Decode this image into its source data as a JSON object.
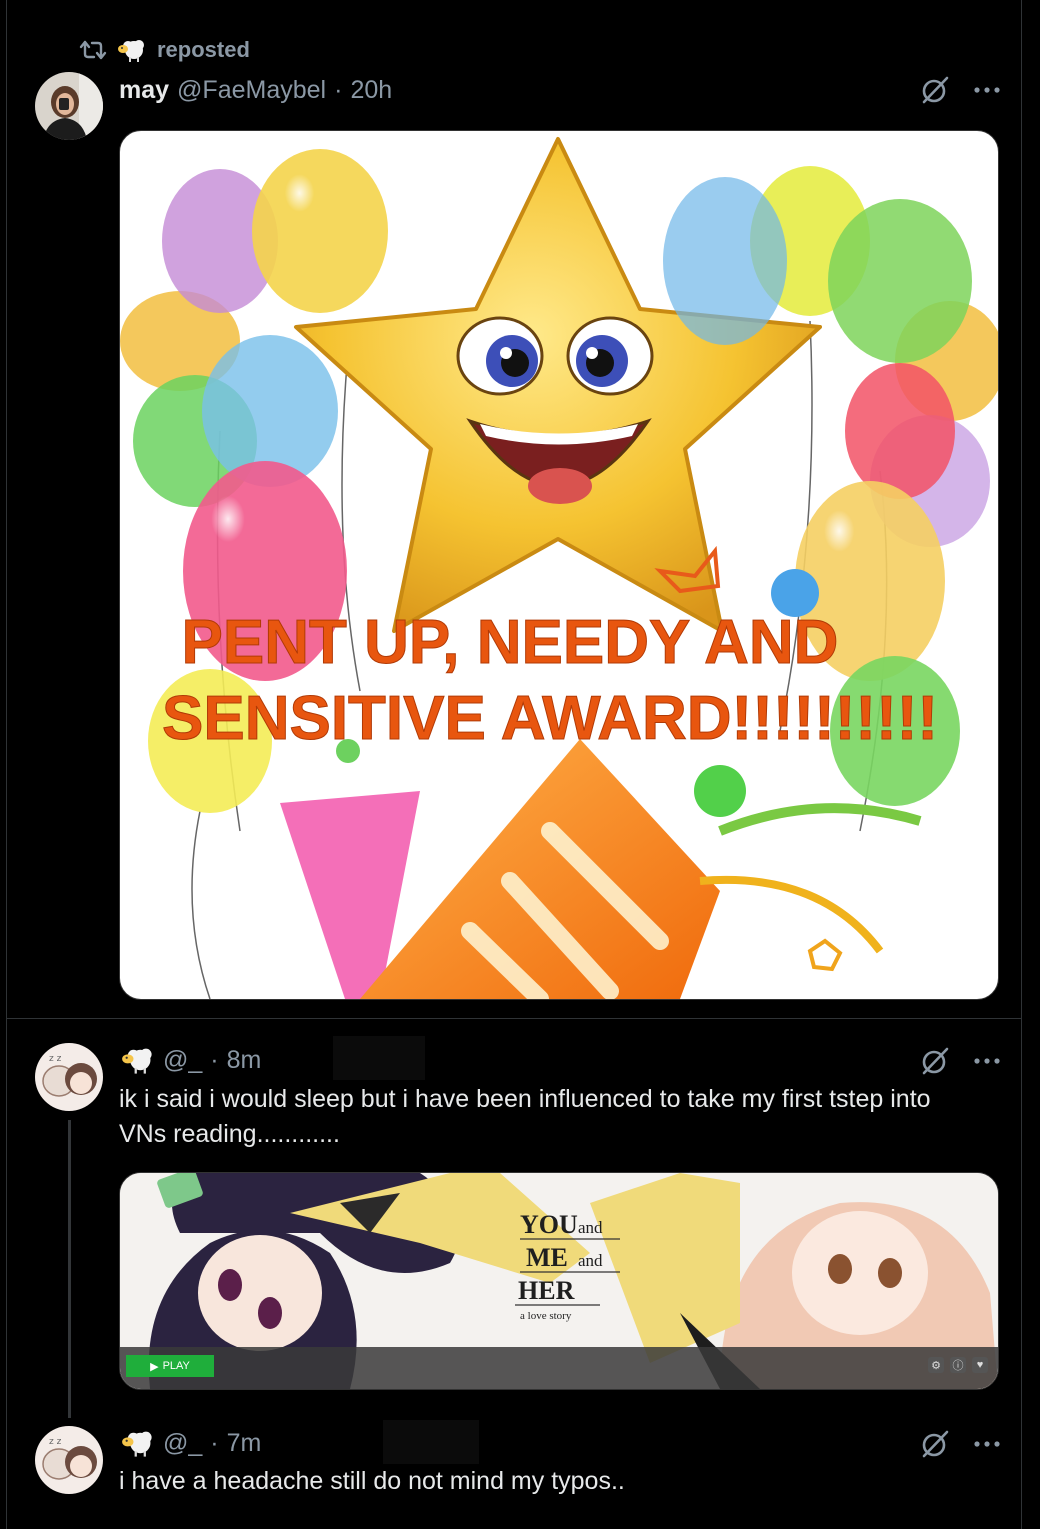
{
  "repost": {
    "label": "reposted"
  },
  "post1": {
    "name": "may",
    "handle": "@FaeMaybel",
    "time": "20h",
    "image": {
      "caption_line1": "PENT UP, NEEDY AND",
      "caption_line2": "SENSITIVE AWARD!!!!!!!!!!"
    }
  },
  "post2": {
    "handle": "@_",
    "time": "8m",
    "text": "ik i said i would sleep but i have been influenced to take my first tstep into VNs reading............",
    "media": {
      "title_line1": "YOU",
      "title_line2": "ME",
      "title_line3": "HER",
      "and": "and",
      "subtitle": "a love story",
      "play_label": "PLAY"
    }
  },
  "post3": {
    "handle": "@_",
    "time": "7m",
    "text": "i have a headache still do not mind my typos.."
  },
  "separator": "·",
  "colors": {
    "background": "#000000",
    "text": "#e7e9ea",
    "muted": "#8b98a5",
    "border": "#2f3336",
    "caption": "#e8560f",
    "play": "#1fae3b"
  },
  "icons": [
    "repost-icon",
    "sheep-icon",
    "grok-icon",
    "more-icon"
  ]
}
